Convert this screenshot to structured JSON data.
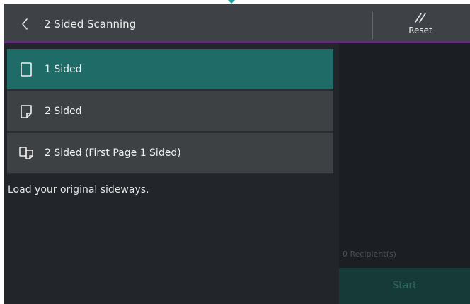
{
  "header": {
    "title": "2 Sided Scanning",
    "back_icon": "chevron-left-icon",
    "reset_label": "Reset",
    "reset_icon": "reset-slashes-icon"
  },
  "options": [
    {
      "label": "1 Sided",
      "icon": "single-page-icon",
      "selected": true
    },
    {
      "label": "2 Sided",
      "icon": "folded-page-icon",
      "selected": false
    },
    {
      "label": "2 Sided (First Page 1 Sided)",
      "icon": "two-pages-icon",
      "selected": false
    }
  ],
  "hint": "Load your original sideways.",
  "side_panel": {
    "recipients": "0 Recipient(s)",
    "start_label": "Start"
  },
  "colors": {
    "header": "#3e4246",
    "accent": "#5f2f74",
    "selected": "#1e6b67",
    "option": "#3e4144",
    "background": "#22252a"
  }
}
